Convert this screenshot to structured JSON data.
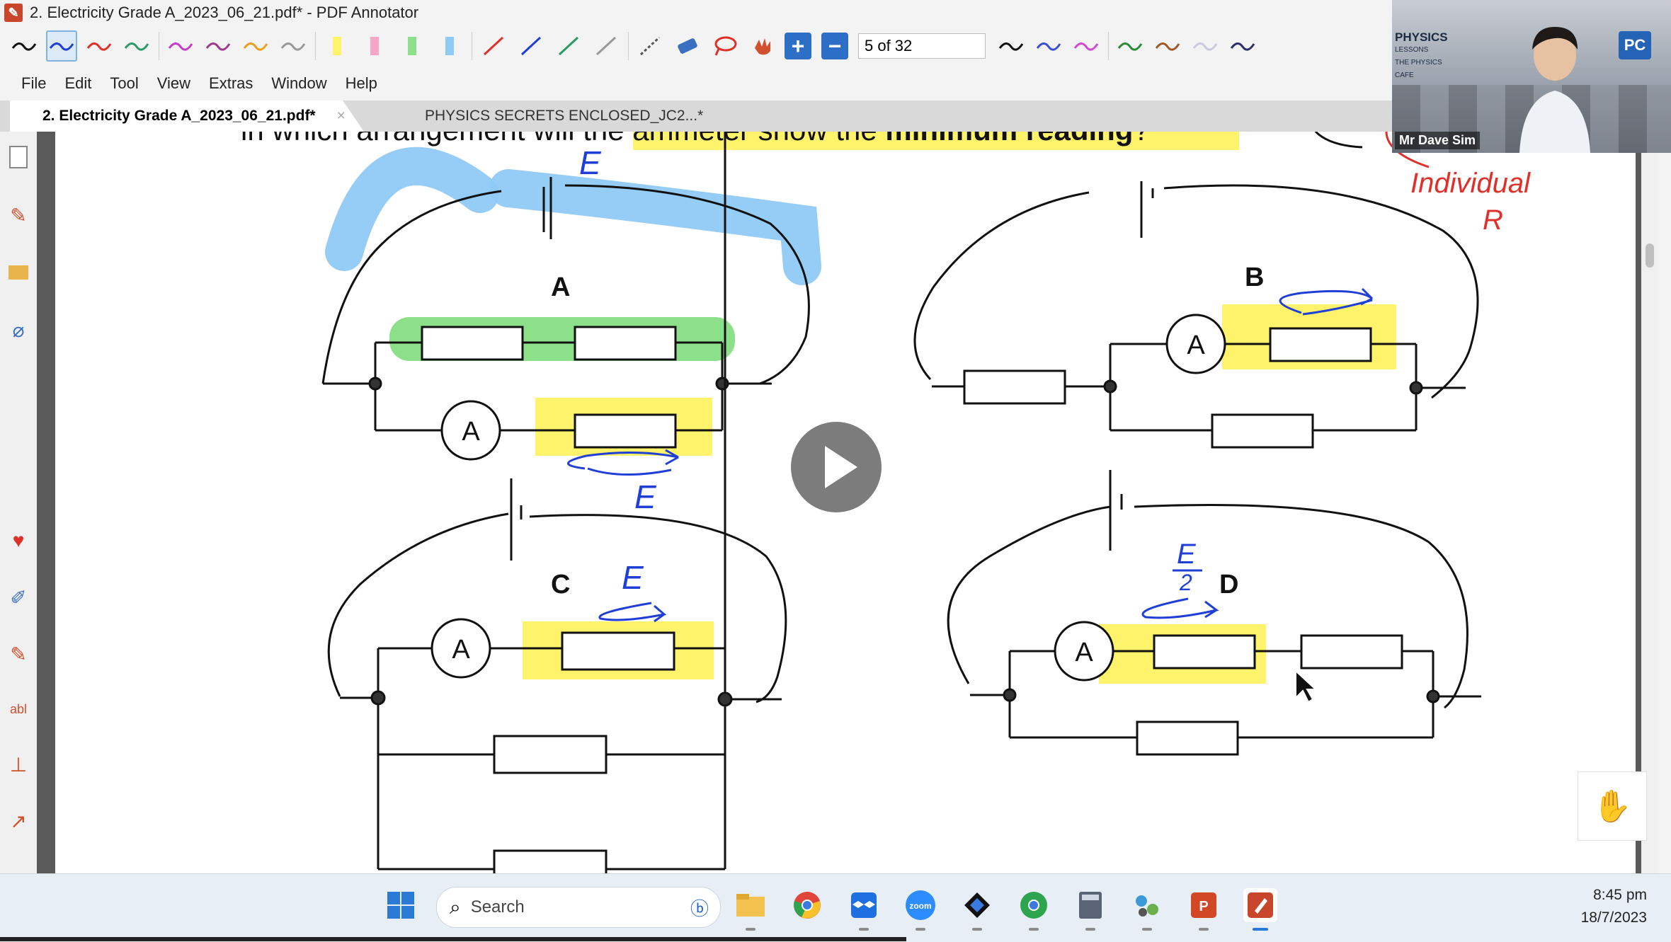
{
  "window": {
    "title": "2. Electricity Grade A_2023_06_21.pdf* - PDF Annotator"
  },
  "toolbar": {
    "page_field": "5 of 32"
  },
  "menu": [
    "File",
    "Edit",
    "Tool",
    "View",
    "Extras",
    "Window",
    "Help"
  ],
  "tabs": [
    {
      "label": "2. Electricity Grade A_2023_06_21.pdf*",
      "active": true
    },
    {
      "label": "PHYSICS SECRETS ENCLOSED_JC2...*",
      "active": false
    }
  ],
  "document": {
    "question_text_visible": "in which arrangement will the ammeter show the",
    "question_bold": "minimum reading",
    "question_end": "?",
    "labels": {
      "a": "A",
      "b": "B",
      "c": "C",
      "d": "D",
      "ammeter": "A"
    },
    "annotations": {
      "emf": "E",
      "emf_half_num": "E",
      "emf_half_den": "2",
      "individual": "Individual",
      "r": "R"
    }
  },
  "webcam": {
    "brand": "PHYSICS",
    "brand_sub": "LESSONS",
    "brand_tag": "THE PHYSICS CAFE",
    "logo": "PC",
    "name": "Mr Dave Sim"
  },
  "taskbar": {
    "search_placeholder": "Search",
    "time": "8:45 pm",
    "date": "18/7/2023"
  },
  "colors": {
    "highlight_yellow": "#fff36b",
    "highlight_green": "#8de08a",
    "highlight_blue": "#8fcaf5",
    "ink_blue": "#1f3fd6",
    "ink_red": "#e0302a",
    "brand_red": "#c8462b"
  }
}
